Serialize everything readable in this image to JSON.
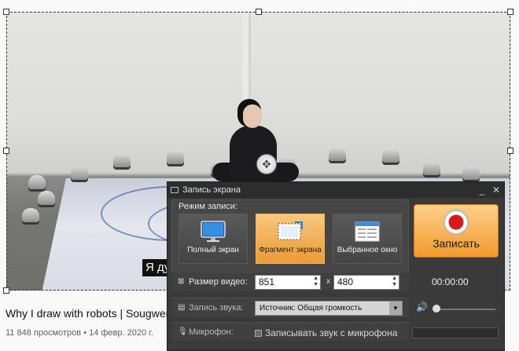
{
  "video": {
    "caption": "Я ду"
  },
  "page": {
    "title": "Why I draw with robots | Sougwen",
    "meta": "11 848 просмотров • 14 февр. 2020 г."
  },
  "recorder": {
    "window_title": "Запись экрана",
    "minimize_glyph": "_",
    "close_glyph": "✕",
    "mode_label": "Режим записи:",
    "modes": [
      {
        "label": "Полный экран",
        "icon": "monitor-icon"
      },
      {
        "label": "Фрагмент экрана",
        "icon": "screen-fragment-icon",
        "active": true
      },
      {
        "label": "Выбранное окно",
        "icon": "window-icon"
      }
    ],
    "record_label": "Записать",
    "timer": "00:00:00",
    "video_size_label": "Размер видео:",
    "width_value": "851",
    "height_value": "480",
    "times_sign": "x",
    "audio_label": "Запись звука:",
    "audio_source": "Источник: Общая громкость",
    "mic_label": "Микрофон:",
    "mic_checkbox_label": "Записывать звук с микрофона",
    "volume_level": 0.0
  },
  "colors": {
    "accent_orange": "#ec9a36",
    "record_red": "#d41a1a",
    "window_bg": "#3a3a3a"
  }
}
